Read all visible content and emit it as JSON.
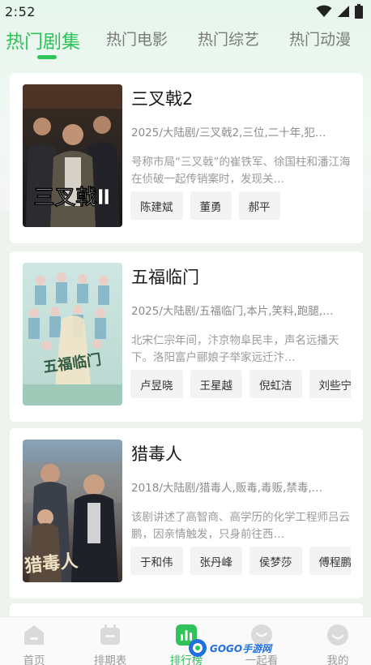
{
  "status_bar": {
    "time": "2:52"
  },
  "tabs": [
    {
      "label": "热门剧集",
      "active": true
    },
    {
      "label": "热门电影",
      "active": false
    },
    {
      "label": "热门综艺",
      "active": false
    },
    {
      "label": "热门动漫",
      "active": false
    }
  ],
  "shows": [
    {
      "title": "三叉戟2",
      "meta": "2025/大陆剧/三叉戟2,三位,二十年,犯…",
      "description": "号称市局“三叉戟”的崔铁军、徐国柱和潘江海在侦破一起传销案时，发现关…",
      "poster_text": "三叉戟Ⅱ",
      "cast": [
        "陈建斌",
        "董勇",
        "郝平"
      ]
    },
    {
      "title": "五福临门",
      "meta": "2025/大陆剧/五福临门,本片,笑料,跑腿,…",
      "description": "北宋仁宗年间，汴京物阜民丰，声名远播天下。洛阳富户郦娘子举家远迁汴…",
      "poster_text": "五福临门",
      "cast": [
        "卢昱晓",
        "王星越",
        "倪虹洁",
        "刘些宁"
      ]
    },
    {
      "title": "猎毒人",
      "meta": "2018/大陆剧/猎毒人,贩毒,毒贩,禁毒,…",
      "description": "该剧讲述了高智商、高学历的化学工程师吕云鹏，因亲情触发，只身前往西…",
      "poster_text": "猎毒人",
      "cast": [
        "于和伟",
        "张丹峰",
        "侯梦莎",
        "傅程鹏"
      ]
    }
  ],
  "bottom_nav": [
    {
      "label": "首页",
      "icon": "home-icon",
      "active": false
    },
    {
      "label": "排期表",
      "icon": "calendar-icon",
      "active": false
    },
    {
      "label": "排行榜",
      "icon": "ranking-icon",
      "active": true
    },
    {
      "label": "一起看",
      "icon": "watch-together-icon",
      "active": false
    },
    {
      "label": "我的",
      "icon": "profile-icon",
      "active": false
    }
  ],
  "watermark": {
    "text": "GOGO手游网"
  },
  "colors": {
    "accent": "#2fc35a",
    "chip_bg": "#f3f3f3"
  }
}
